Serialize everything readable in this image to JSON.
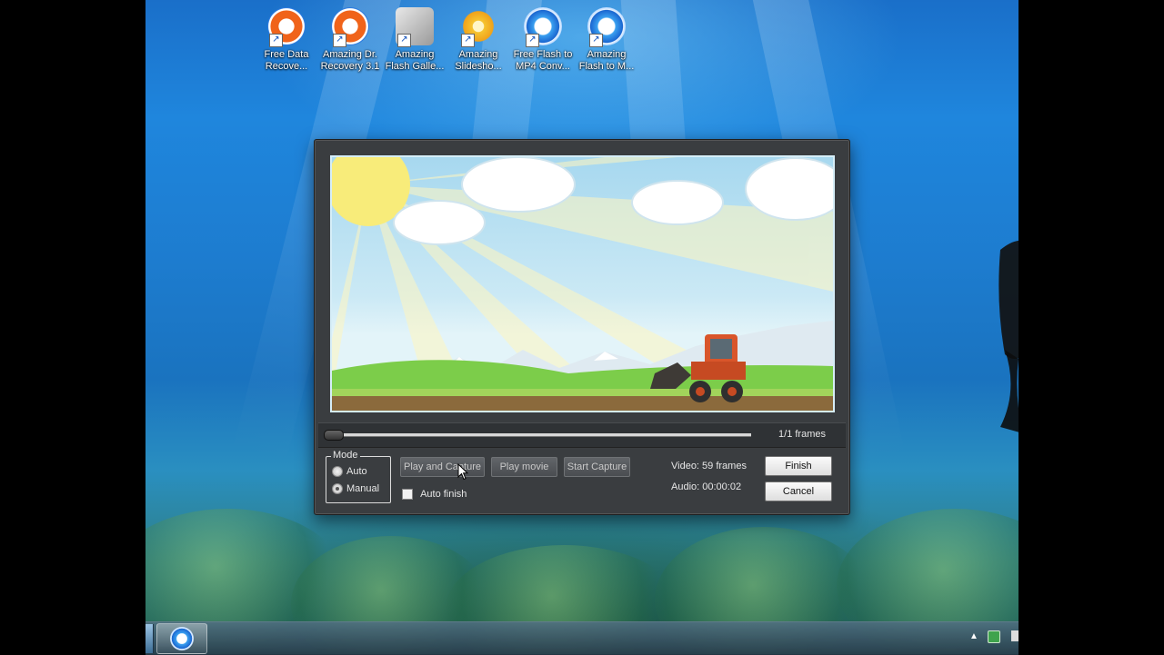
{
  "desktop_icons": [
    {
      "label_line1": "Free Data",
      "label_line2": "Recove...",
      "icon": "recovery-lifebuoy-icon"
    },
    {
      "label_line1": "Amazing Dr.",
      "label_line2": "Recovery 3.1",
      "icon": "recovery-lifebuoy-icon"
    },
    {
      "label_line1": "Amazing",
      "label_line2": "Flash Galle...",
      "icon": "flash-gallery-icon"
    },
    {
      "label_line1": "Amazing",
      "label_line2": "Slidesho...",
      "icon": "slideshow-flower-icon"
    },
    {
      "label_line1": "Free Flash to",
      "label_line2": "MP4 Conv...",
      "icon": "flash-converter-icon"
    },
    {
      "label_line1": "Amazing",
      "label_line2": "Flash to M...",
      "icon": "flash-converter-icon"
    }
  ],
  "dialog": {
    "frames_counter": "1/1  frames",
    "playback_progress": 0.0,
    "mode": {
      "legend": "Mode",
      "options": [
        "Auto",
        "Manual"
      ],
      "selected": "Manual"
    },
    "buttons": {
      "play_and_capture": "Play and Capture",
      "play_movie": "Play movie",
      "start_capture": "Start Capture",
      "finish": "Finish",
      "cancel": "Cancel"
    },
    "auto_finish": {
      "label": "Auto finish",
      "checked": false
    },
    "stats": {
      "video": "Video: 59 frames",
      "audio": "Audio: 00:00:02"
    }
  },
  "taskbar": {
    "running_app_icon": "flash-converter-icon",
    "tray_icons": [
      "show-hidden-icons-chevron",
      "green-tray-icon",
      "action-center-flag-icon"
    ],
    "tray_chevron_glyph": "▲"
  },
  "colors": {
    "dialog_bg": "#3a3d40",
    "preview_border": "#d6eef8",
    "desktop_water": "#1f86dd"
  }
}
